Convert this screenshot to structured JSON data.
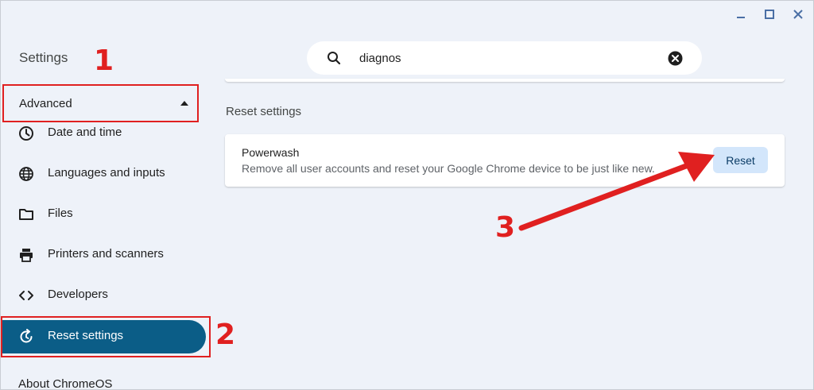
{
  "app": {
    "title": "Settings"
  },
  "search": {
    "value": "diagnos",
    "placeholder": ""
  },
  "sidebar": {
    "section_label": "Advanced",
    "items": [
      {
        "label": "Date and time",
        "icon": "clock-icon"
      },
      {
        "label": "Languages and inputs",
        "icon": "globe-icon"
      },
      {
        "label": "Files",
        "icon": "folder-icon"
      },
      {
        "label": "Printers and scanners",
        "icon": "printer-icon"
      },
      {
        "label": "Developers",
        "icon": "code-icon"
      },
      {
        "label": "Reset settings",
        "icon": "reset-icon",
        "active": true
      }
    ],
    "about_label": "About ChromeOS"
  },
  "main": {
    "section_title": "Reset settings",
    "card": {
      "title": "Powerwash",
      "description": "Remove all user accounts and reset your Google Chrome device to be just like new.",
      "button_label": "Reset"
    }
  },
  "annotations": {
    "marker_1": "1",
    "marker_2": "2",
    "marker_3": "3"
  },
  "colors": {
    "background": "#eef2f9",
    "active_item": "#0b5d87",
    "reset_button": "#d3e6fb",
    "annotation": "#e02020"
  }
}
